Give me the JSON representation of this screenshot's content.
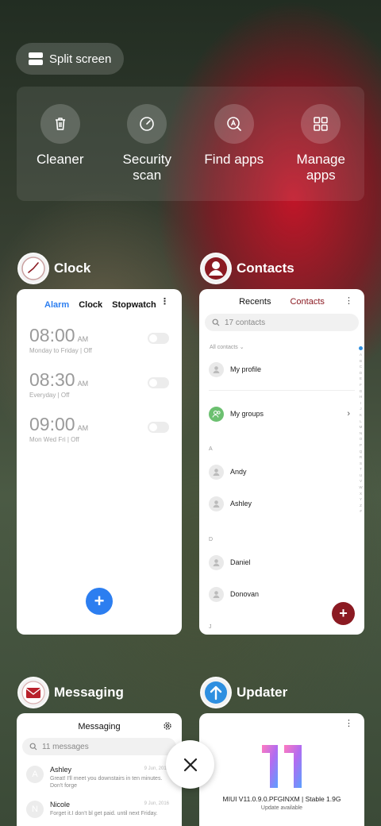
{
  "split_screen": {
    "label": "Split screen",
    "icon": "split-screen-icon"
  },
  "tools": [
    {
      "label": "Cleaner",
      "icon": "trash-icon"
    },
    {
      "label": "Security\nscan",
      "icon": "security-scan-icon"
    },
    {
      "label": "Find apps",
      "icon": "find-apps-icon"
    },
    {
      "label": "Manage\napps",
      "icon": "grid-icon"
    }
  ],
  "apps": {
    "clock": {
      "name": "Clock",
      "tabs": [
        "Alarm",
        "Clock",
        "Stopwatch"
      ],
      "alarms": [
        {
          "time": "08:00",
          "ampm": "AM",
          "days": "Monday to Friday | Off"
        },
        {
          "time": "08:30",
          "ampm": "AM",
          "days": "Everyday | Off"
        },
        {
          "time": "09:00",
          "ampm": "AM",
          "days": "Mon Wed Fri | Off"
        }
      ],
      "fab": "+",
      "accent": "#2c7ef0"
    },
    "contacts": {
      "name": "Contacts",
      "tabs": [
        "Recents",
        "Contacts"
      ],
      "search_placeholder": "17 contacts",
      "filter": "All contacts",
      "my_profile": "My profile",
      "my_groups": "My groups",
      "sections": [
        {
          "letter": "A",
          "names": [
            "Andy",
            "Ashley"
          ]
        },
        {
          "letter": "D",
          "names": [
            "Daniel",
            "Donovan"
          ]
        }
      ],
      "trailing_letter": "J",
      "alphabet": [
        "A",
        "B",
        "C",
        "D",
        "E",
        "F",
        "G",
        "H",
        "I",
        "J",
        "K",
        "L",
        "M",
        "N",
        "O",
        "P",
        "Q",
        "R",
        "S",
        "T",
        "U",
        "V",
        "W",
        "X",
        "Y",
        "Z",
        "#"
      ],
      "fab": "+",
      "accent": "#8b1a22"
    },
    "messaging": {
      "name": "Messaging",
      "title": "Messaging",
      "search_placeholder": "11 messages",
      "messages": [
        {
          "initial": "A",
          "name": "Ashley",
          "snippet": "Great! I'll meet you downstairs in ten minutes. Don't forge",
          "date": "9 Jun, 2016"
        },
        {
          "initial": "N",
          "name": "Nicole",
          "snippet": "Forget it.I don't bl get paid. until next Friday.",
          "date": "9 Jun, 2016"
        }
      ]
    },
    "updater": {
      "name": "Updater",
      "version": "MIUI V11.0.9.0.PFGINXM | Stable 1.9G",
      "status": "Update available"
    }
  },
  "close_button": {
    "icon": "close-icon",
    "symbol": "✕"
  },
  "menu_symbol": "⋮"
}
